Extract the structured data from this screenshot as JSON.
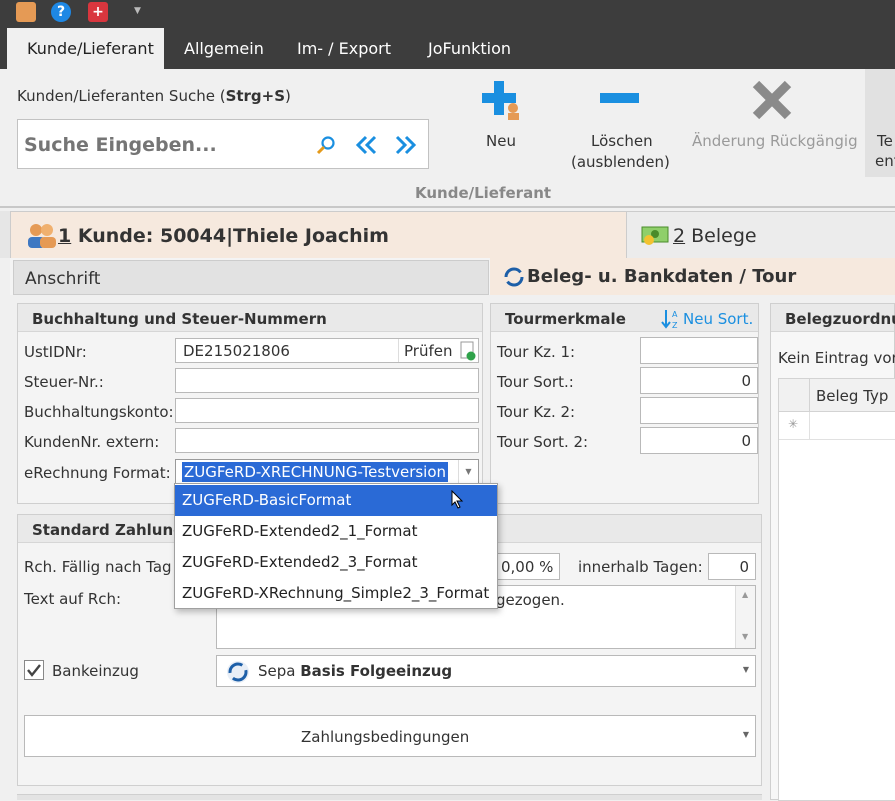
{
  "ribbon_tabs": [
    "Kunde/Lieferant",
    "Allgemein",
    "Im- / Export",
    "JoFunktion"
  ],
  "search": {
    "title_plain": "Kunden/Lieferanten Suche (",
    "title_bold": "Strg+S",
    "title_end": ")",
    "placeholder": "Suche Eingeben..."
  },
  "actions": {
    "neu": "Neu",
    "loeschen_1": "Löschen",
    "loeschen_2": "(ausblenden)",
    "rueckgaengig": "Änderung Rückgängig",
    "cut_1": "Te",
    "cut_2": "ent"
  },
  "group_label": "Kunde/Lieferant",
  "doc_tabs": {
    "tab1_num": "1",
    "tab1": " Kunde: 50044|Thiele Joachim",
    "tab2_num": "2",
    "tab2": " Belege"
  },
  "sub_tabs": {
    "anschrift": "Anschrift",
    "beleg": "Beleg- u. Bankdaten / Tour"
  },
  "buch": {
    "title": "Buchhaltung und Steuer-Nummern",
    "ustid_label": "UstIDNr:",
    "ustid_value": "DE215021806",
    "pruefen": "Prüfen",
    "steuer_label": "Steuer-Nr.:",
    "konto_label": "Buchhaltungskonto:",
    "kundennr_label": "KundenNr. extern:",
    "erech_label": "eRechnung Format:",
    "erech_value": "ZUGFeRD-XRECHNUNG-Testversion"
  },
  "tour": {
    "title": "Tourmerkmale",
    "neusort": "Neu Sort.",
    "kz1": "Tour Kz. 1:",
    "sort1": "Tour Sort.:",
    "sort1_val": "0",
    "kz2": "Tour Kz. 2:",
    "sort2": "Tour Sort. 2:",
    "sort2_val": "0"
  },
  "beleg": {
    "title": "Belegzuordnu",
    "empty": "Kein Eintrag vor",
    "col": "Beleg Typ",
    "newrow": "✳"
  },
  "zahl": {
    "title": "Standard Zahlung",
    "faellig": "Rch. Fällig nach Tag",
    "pct": "0,00 %",
    "innerhalb": "innerhalb Tagen:",
    "innerhalb_val": "0",
    "text_label": "Text auf Rch:",
    "text_value": "gezogen.",
    "bankeinzug": "Bankeinzug",
    "sepa_plain": "Sepa ",
    "sepa_bold": "Basis Folgeeinzug",
    "zb": "Zahlungsbedingungen"
  },
  "dropdown": [
    "ZUGFeRD-BasicFormat",
    "ZUGFeRD-Extended2_1_Format",
    "ZUGFeRD-Extended2_3_Format",
    "ZUGFeRD-XRechnung_Simple2_3_Format"
  ],
  "colors": {
    "accent": "#1a8fe0",
    "selection": "#2a6ad6",
    "dark": "#3d3d3d",
    "tab_active_bg": "#f6e9de"
  }
}
